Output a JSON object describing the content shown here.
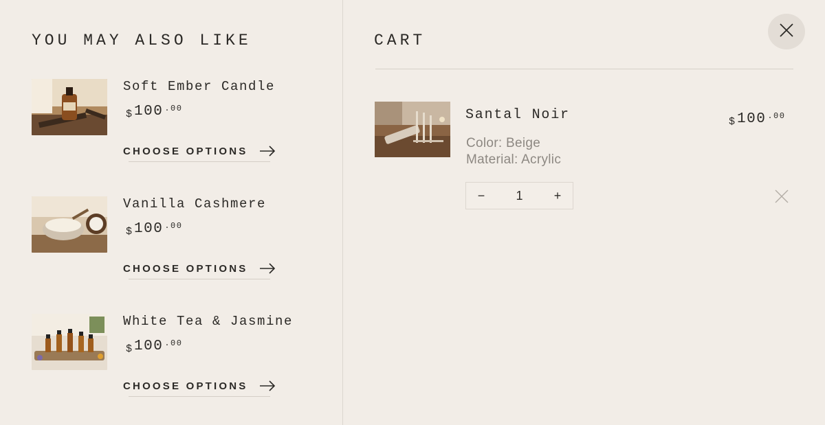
{
  "recommendations": {
    "title": "YOU MAY ALSO LIKE",
    "items": [
      {
        "name": "Soft Ember Candle",
        "price": {
          "currency": "$",
          "whole": "100",
          "cents": ".00"
        },
        "cta": "CHOOSE OPTIONS"
      },
      {
        "name": "Vanilla Cashmere",
        "price": {
          "currency": "$",
          "whole": "100",
          "cents": ".00"
        },
        "cta": "CHOOSE OPTIONS"
      },
      {
        "name": "White Tea & Jasmine",
        "price": {
          "currency": "$",
          "whole": "100",
          "cents": ".00"
        },
        "cta": "CHOOSE OPTIONS"
      }
    ]
  },
  "cart": {
    "title": "CART",
    "items": [
      {
        "name": "Santal Noir",
        "color": "Color: Beige",
        "material": "Material: Acrylic",
        "price": {
          "currency": "$",
          "whole": "100",
          "cents": ".00"
        },
        "quantity": "1",
        "minus": "−",
        "plus": "+"
      }
    ]
  },
  "icons": {
    "close": "close-icon",
    "arrow": "arrow-right-icon",
    "remove": "remove-icon"
  },
  "colors": {
    "background": "#f2ede7",
    "text": "#2b2926",
    "muted": "#8d8882",
    "close_button_bg": "#e3ddd6"
  }
}
